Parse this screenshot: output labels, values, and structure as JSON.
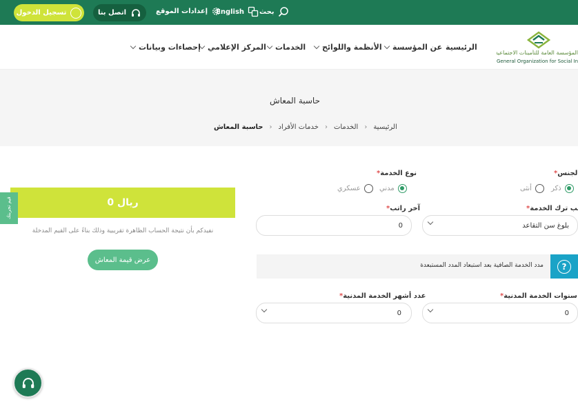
{
  "topbar": {
    "login": "تسجيل الدخول",
    "contact": "اتصل بنا",
    "settings": "إعدادات الموقع",
    "language": "English",
    "search": "بحث",
    "color": "#1e7a55"
  },
  "nav": {
    "logo_ar": "المؤسسة العامة للتأمينات الاجتماعية",
    "logo_en": "General Organization for Social Insurance",
    "items": [
      "الرئيسية",
      "عن المؤسسة",
      "الأنظمة واللوائح",
      "الخدمات",
      "المركز الإعلامي",
      "إحصاءات وبيانات"
    ]
  },
  "page": {
    "title": "حاسبة المعاش",
    "breadcrumb": [
      "الرئيسية",
      "الخدمات",
      "خدمات الأفراد",
      "حاسبة المعاش"
    ]
  },
  "form": {
    "gender": {
      "label": "الجنس",
      "options": [
        "ذكر",
        "أنثى"
      ],
      "selected": "ذكر"
    },
    "service_type": {
      "label": "نوع الخدمة",
      "options": [
        "مدني",
        "عسكري"
      ],
      "selected": "مدني"
    },
    "leave_reason": {
      "label": "سبب ترك الخدمة",
      "value": "بلوغ سن التقاعد"
    },
    "last_salary": {
      "label": "آخر راتب",
      "value": "0"
    },
    "info_text": "مدد الخدمة الصافية بعد استبعاد المدد المستبعدة",
    "civil_years": {
      "label": "عدد سنوات الخدمة المدنية",
      "value": "0"
    },
    "civil_months": {
      "label": "عدد أشهر الخدمة المدنية",
      "value": "0"
    }
  },
  "result": {
    "value": "0 ريال",
    "note": "نفيدكم بأن نتيجة الحساب الظاهرة تقريبية وذلك بناءً على القيم المدخلة",
    "button": "عرض قيمة المعاش"
  },
  "side_tab": "قيم تجربتك",
  "colors": {
    "green": "#1e7a55",
    "lime": "#cfe33a",
    "mint": "#5bbe8c",
    "info": "#1aa3c7"
  }
}
